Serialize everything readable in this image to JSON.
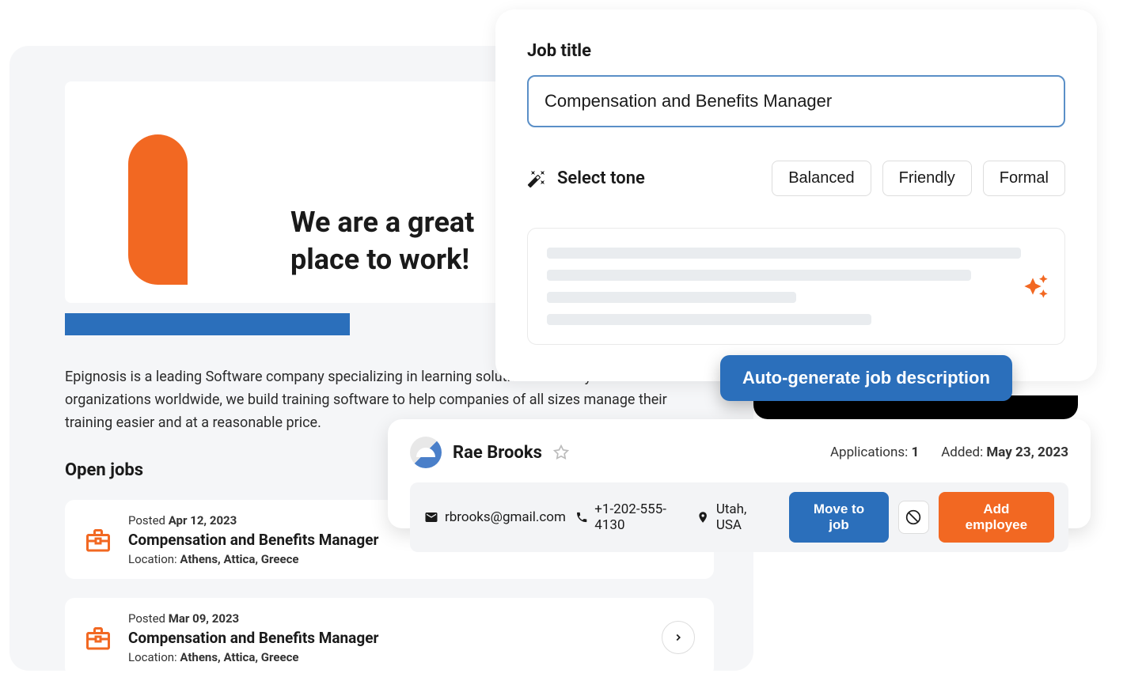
{
  "hero": {
    "headline_line1": "We are a great",
    "headline_line2": "place to work!"
  },
  "company_description": "Epignosis is a leading Software company specializing in learning solutions. Used by thousands of organizations worldwide, we build training software to help companies of all sizes manage their training easier and at a reasonable price.",
  "open_jobs": {
    "heading": "Open jobs",
    "items": [
      {
        "posted_label": "Posted ",
        "posted_date": "Apr 12, 2023",
        "title": "Compensation and Benefits Manager",
        "location_label": "Location: ",
        "location": "Athens, Attica, Greece"
      },
      {
        "posted_label": "Posted ",
        "posted_date": "Mar 09, 2023",
        "title": "Compensation and Benefits Manager",
        "location_label": "Location: ",
        "location": "Athens, Attica, Greece"
      }
    ]
  },
  "ai_panel": {
    "job_title_label": "Job title",
    "job_title_value": "Compensation and Benefits Manager",
    "tone_label": "Select tone",
    "tones": [
      "Balanced",
      "Friendly",
      "Formal"
    ],
    "auto_generate_label": "Auto-generate job description"
  },
  "candidate": {
    "name": "Rae Brooks",
    "applications_label": "Applications: ",
    "applications_count": "1",
    "added_label": "Added: ",
    "added_date": "May 23, 2023",
    "email": "rbrooks@gmail.com",
    "phone": "+1-202-555-4130",
    "location": "Utah, USA",
    "move_label": "Move to job",
    "add_label": "Add employee"
  }
}
